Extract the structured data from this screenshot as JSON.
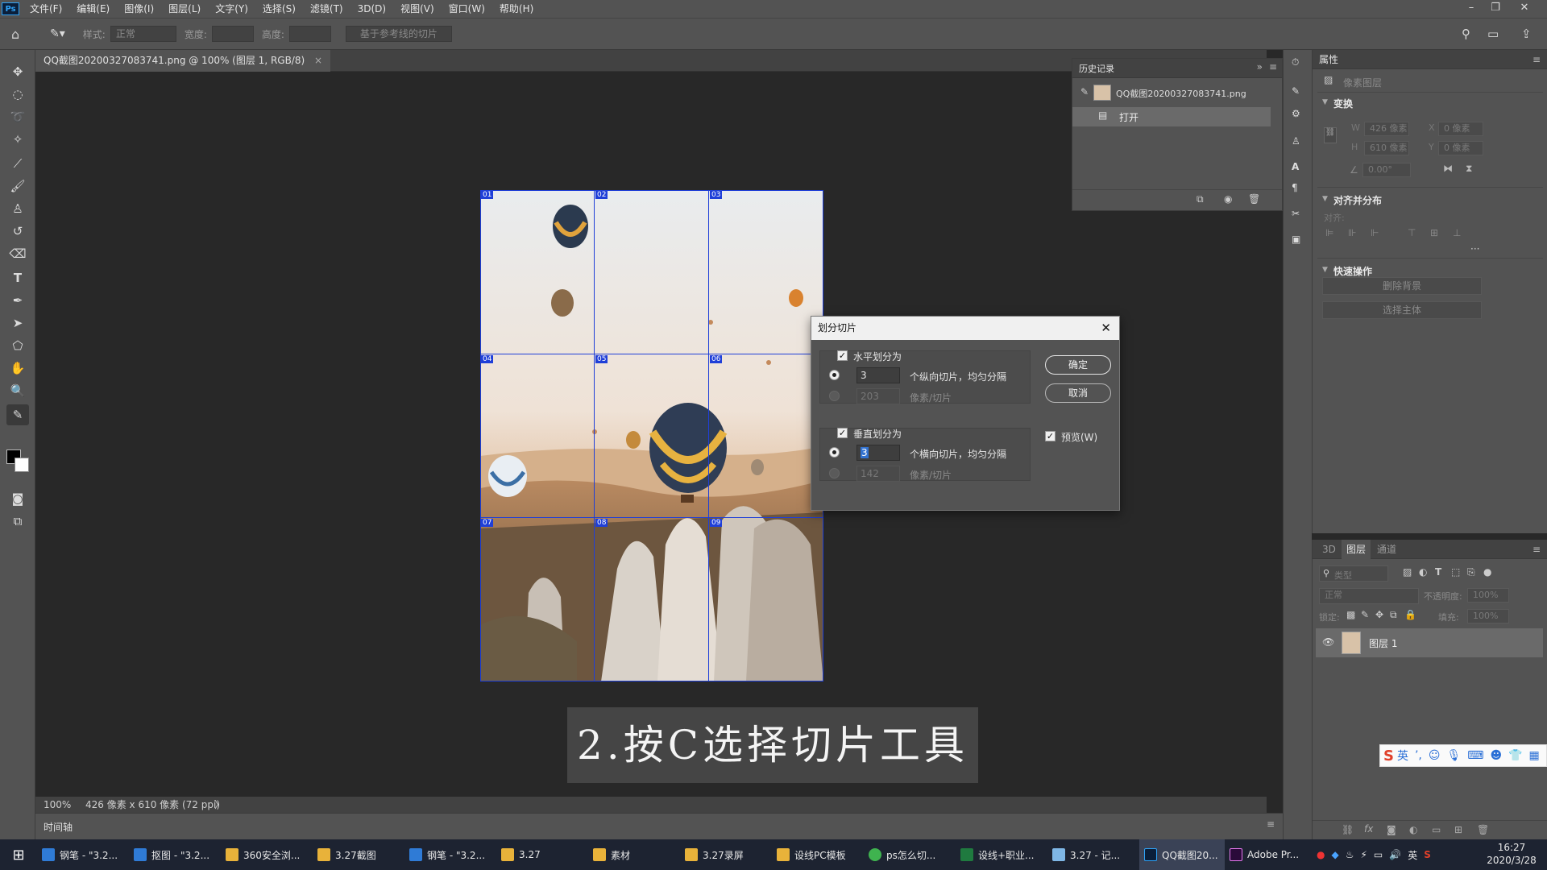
{
  "app": {
    "logo": "Ps"
  },
  "menu": [
    "文件(F)",
    "编辑(E)",
    "图像(I)",
    "图层(L)",
    "文字(Y)",
    "选择(S)",
    "滤镜(T)",
    "3D(D)",
    "视图(V)",
    "窗口(W)",
    "帮助(H)"
  ],
  "options": {
    "style_label": "样式:",
    "style_value": "正常",
    "width_label": "宽度:",
    "height_label": "高度:",
    "guides_button": "基于参考线的切片"
  },
  "doc_tab": {
    "title": "QQ截图20200327083741.png @ 100% (图层 1, RGB/8)",
    "close": "×"
  },
  "slices": [
    "01",
    "02",
    "03",
    "04",
    "05",
    "06",
    "07",
    "08",
    "09"
  ],
  "history": {
    "tab": "历史记录",
    "snapshot": "QQ截图20200327083741.png",
    "steps": [
      "打开"
    ]
  },
  "properties": {
    "tab": "属性",
    "kind": "像素图层",
    "transform_title": "变换",
    "w_label": "W",
    "w": "426 像素",
    "h_label": "H",
    "h": "610 像素",
    "x_label": "X",
    "x": "0 像素",
    "y_label": "Y",
    "y": "0 像素",
    "angle": "0.00°",
    "align_title": "对齐并分布",
    "align_label": "对齐:",
    "more": "···",
    "quick_title": "快速操作",
    "remove_bg": "删除背景",
    "select_subject": "选择主体"
  },
  "layers": {
    "tabs": [
      "3D",
      "图层",
      "通道"
    ],
    "filter_placeholder": "类型",
    "blend": "正常",
    "opacity_label": "不透明度:",
    "opacity": "100%",
    "lock_label": "锁定:",
    "fill_label": "填充:",
    "fill": "100%",
    "layer_name": "图层 1"
  },
  "status": {
    "zoom": "100%",
    "info": "426 像素 x 610 像素 (72 ppi)",
    "arrow": "〉"
  },
  "timeline": {
    "label": "时间轴"
  },
  "dialog": {
    "title": "划分切片",
    "h_check": "水平划分为",
    "h_count": "3",
    "h_count_suffix": "个纵向切片，均匀分隔",
    "h_pixels": "203",
    "h_pixels_suffix": "像素/切片",
    "v_check": "垂直划分为",
    "v_count": "3",
    "v_count_suffix": "个横向切片，均匀分隔",
    "v_pixels": "142",
    "v_pixels_suffix": "像素/切片",
    "ok": "确定",
    "cancel": "取消",
    "preview": "预览(W)"
  },
  "caption": "2.按C选择切片工具",
  "taskbar": {
    "items": [
      "钢笔 - \"3.2...",
      "抠图 - \"3.2...",
      "360安全浏...",
      "3.27截图",
      "钢笔 - \"3.2...",
      "3.27",
      "素材",
      "3.27录屏",
      "设线PC模板",
      "ps怎么切...",
      "设线+职业...",
      "3.27 - 记...",
      "QQ截图20...",
      "Adobe Pr..."
    ],
    "lang": "英",
    "time": "16:27",
    "date": "2020/3/28"
  },
  "ime": {
    "lang": "英"
  },
  "colors": {
    "slice_blue": "#1f3fd8",
    "dark_bg": "#282828",
    "panel": "#535353",
    "accent": "#3272d0"
  }
}
